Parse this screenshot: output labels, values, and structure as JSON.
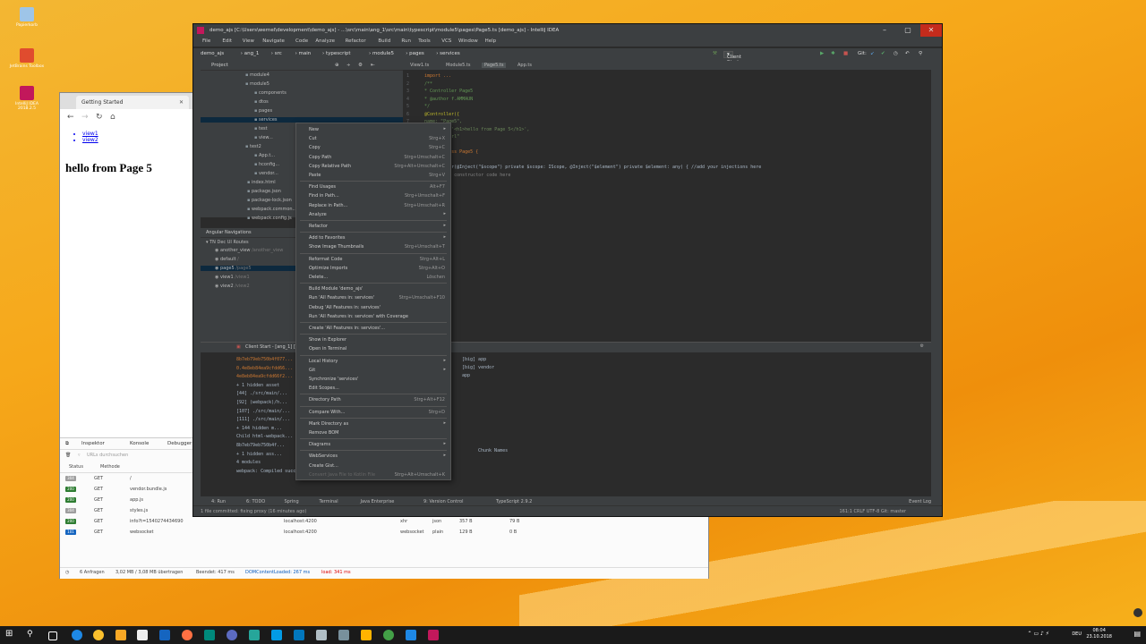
{
  "desktop": {
    "icons": [
      {
        "label": "Papierkorb",
        "color": "#9ec5e8"
      },
      {
        "label": "JetBrains Toolbox",
        "color": "#e04c2e"
      },
      {
        "label": "IntelliJ IDEA 2018.2.5",
        "color": "#c2185b"
      }
    ]
  },
  "browser": {
    "tab_title": "Getting Started",
    "links": [
      "view1",
      "view2"
    ],
    "heading": "hello from Page 5",
    "devtools": {
      "tabs": [
        "Inspektor",
        "Konsole",
        "Debugger"
      ],
      "filter_placeholder": "URLs durchsuchen",
      "columns": {
        "status": "Status",
        "method": "Methode"
      },
      "rows": [
        {
          "status": "304",
          "method": "GET",
          "file": "/",
          "domain": "",
          "type": "",
          "transfer": "",
          "size": ""
        },
        {
          "status": "200",
          "method": "GET",
          "file": "vendor.bundle.js",
          "domain": "",
          "type": "",
          "transfer": "",
          "size": ""
        },
        {
          "status": "200",
          "method": "GET",
          "file": "app.js",
          "domain": "",
          "type": "",
          "transfer": "",
          "size": ""
        },
        {
          "status": "304",
          "method": "GET",
          "file": "styles.js",
          "domain": "",
          "type": "",
          "transfer": "",
          "size": ""
        },
        {
          "status": "200",
          "method": "GET",
          "file": "info?t=1540274434690",
          "domain": "localhost:4200",
          "type": "xhr",
          "subtype": "json",
          "transfer": "357 B",
          "size": "79 B"
        },
        {
          "status": "101",
          "method": "GET",
          "file": "websocket",
          "domain": "localhost:4200",
          "type": "websocket",
          "subtype": "plain",
          "transfer": "129 B",
          "size": "0 B"
        }
      ],
      "summary": {
        "requests": "6 Anfragen",
        "transferred": "3,02 MB / 3,08 MB übertragen",
        "finished": "Beendet: 417 ms",
        "dcl": "DOMContentLoaded: 267 ms",
        "load": "load: 341 ms"
      }
    }
  },
  "ide": {
    "title": "demo_ajs [C:\\Users\\wernel\\development\\demo_ajs] - ...\\src\\main\\ang_1\\src\\main\\typescript\\module5\\pages\\Page5.ts [demo_ajs] - IntelliJ IDEA",
    "menu": [
      "File",
      "Edit",
      "View",
      "Navigate",
      "Code",
      "Analyze",
      "Refactor",
      "Build",
      "Run",
      "Tools",
      "VCS",
      "Window",
      "Help"
    ],
    "breadcrumbs": [
      "demo_ajs",
      "ang_1",
      "src",
      "main",
      "typescript",
      "module5",
      "pages",
      "services"
    ],
    "run_config": "Client Start - [ang_1] [TinyDao]",
    "git_label": "Git:",
    "project_panel_title": "Project",
    "tree": [
      {
        "label": "module4",
        "indent": 1
      },
      {
        "label": "module5",
        "indent": 1
      },
      {
        "label": "components",
        "indent": 2
      },
      {
        "label": "dtos",
        "indent": 2
      },
      {
        "label": "pages",
        "indent": 2
      },
      {
        "label": "services",
        "indent": 2,
        "selected": true
      },
      {
        "label": "test",
        "indent": 2
      },
      {
        "label": "view...",
        "indent": 2
      },
      {
        "label": "test2",
        "indent": 1
      },
      {
        "label": "App.t...",
        "indent": 2
      },
      {
        "label": "hconfig...",
        "indent": 2
      },
      {
        "label": "vendor...",
        "indent": 2
      },
      {
        "label": "index.html",
        "indent": 0
      },
      {
        "label": "package.json",
        "indent": 0
      },
      {
        "label": "package-lock.json",
        "indent": 0
      },
      {
        "label": "webpack.common...",
        "indent": 0
      },
      {
        "label": "webpack.config.js",
        "indent": 0
      }
    ],
    "editor_tabs": [
      "View1.ts",
      "Module5.ts",
      "Page5.ts",
      "App.ts"
    ],
    "code_lines": [
      {
        "text": "import ...",
        "color": "#cc7832"
      },
      {
        "text": "/**",
        "color": "#629755"
      },
      {
        "text": " * Controller Page5",
        "color": "#629755"
      },
      {
        "text": " * @author f.AMMAUN",
        "color": "#629755"
      },
      {
        "text": " */",
        "color": "#629755"
      },
      {
        "text": "@Controller({",
        "color": "#bbb529"
      },
      {
        "text": "    name: \"Page5\",",
        "color": "#6a8759"
      },
      {
        "text": "    template: '<h1>hello from Page 5</h1>',",
        "color": "#6a8759"
      },
      {
        "text": "    alias: \"ctrl\"",
        "color": "#6a8759"
      },
      {
        "text": "})",
        "color": "#a9b7c6"
      },
      {
        "text": "export class Page5 {",
        "color": "#cc7832"
      },
      {
        "text": "",
        "color": "#a9b7c6"
      },
      {
        "text": "    constructor(@Inject(\"$scope\") private $scope: IScope, @Inject(\"$element\") private $element: any) { //add your injections here",
        "color": "#a9b7c6"
      },
      {
        "text": "        //add your constructor code here",
        "color": "#808080"
      },
      {
        "text": "    }",
        "color": "#a9b7c6"
      },
      {
        "text": "}",
        "color": "#a9b7c6"
      }
    ],
    "angular_nav": {
      "title": "Angular Navigations",
      "group": "TN Dec UI Routes",
      "items": [
        {
          "label": "another_view",
          "path": "/another_view"
        },
        {
          "label": "default",
          "path": "/"
        },
        {
          "label": "page5",
          "path": "/page5",
          "selected": true
        },
        {
          "label": "view1",
          "path": "/view1"
        },
        {
          "label": "view2",
          "path": "/view2"
        }
      ]
    },
    "run_panel": {
      "title": "Client Start - [ang_1] [TinyDao]",
      "lines": [
        "8b7eb79eb750b4f077...",
        "0.4e8eb84ea9cfdd66...",
        "4e8eb84ea9cfdd66f2...",
        "+ 1 hidden asset",
        "[44] ./src/main/...",
        "[92] (webpack)/h...",
        "[107] ./src/main/...",
        "[111] ./src/main/...",
        "+ 144 hidden m...",
        "Child html-webpack...",
        "8b7eb79eb750b4f...",
        "+ 1 hidden ass...",
        "4 modules",
        "webpack: Compiled successfully."
      ],
      "right": [
        "[big]  app",
        "[big]  vendor",
        "       app",
        "Chunk Names"
      ]
    },
    "bottom_tabs": [
      "4: Run",
      "6: TODO",
      "Spring",
      "Terminal",
      "Java Enterprise",
      "9: Version Control",
      "TypeScript 2.9.2"
    ],
    "event_log": "Event Log",
    "status_left": "1 file committed: fixing proxy (16 minutes ago)",
    "status_right": "161:1  CRLF  UTF-8  Git: master"
  },
  "context_menu": [
    {
      "label": "New",
      "sub": true
    },
    {
      "label": "Cut",
      "sc": "Strg+X"
    },
    {
      "label": "Copy",
      "sc": "Strg+C"
    },
    {
      "label": "Copy Path",
      "sc": "Strg+Umschalt+C"
    },
    {
      "label": "Copy Relative Path",
      "sc": "Strg+Alt+Umschalt+C"
    },
    {
      "label": "Paste",
      "sc": "Strg+V"
    },
    {
      "sep": true
    },
    {
      "label": "Find Usages",
      "sc": "Alt+F7"
    },
    {
      "label": "Find in Path...",
      "sc": "Strg+Umschalt+F"
    },
    {
      "label": "Replace in Path...",
      "sc": "Strg+Umschalt+R"
    },
    {
      "label": "Analyze",
      "sub": true
    },
    {
      "sep": true
    },
    {
      "label": "Refactor",
      "sub": true
    },
    {
      "sep": true
    },
    {
      "label": "Add to Favorites",
      "sub": true
    },
    {
      "label": "Show Image Thumbnails",
      "sc": "Strg+Umschalt+T"
    },
    {
      "sep": true
    },
    {
      "label": "Reformat Code",
      "sc": "Strg+Alt+L"
    },
    {
      "label": "Optimize Imports",
      "sc": "Strg+Alt+O"
    },
    {
      "label": "Delete...",
      "sc": "Löschen"
    },
    {
      "sep": true
    },
    {
      "label": "Build Module 'demo_ajs'"
    },
    {
      "label": "Run 'All Features in: services'",
      "sc": "Strg+Umschalt+F10"
    },
    {
      "label": "Debug 'All Features in: services'"
    },
    {
      "label": "Run 'All Features in: services' with Coverage"
    },
    {
      "sep": true
    },
    {
      "label": "Create 'All Features in: services'..."
    },
    {
      "sep": true
    },
    {
      "label": "Show in Explorer"
    },
    {
      "label": "Open in Terminal"
    },
    {
      "sep": true
    },
    {
      "label": "Local History",
      "sub": true
    },
    {
      "label": "Git",
      "sub": true
    },
    {
      "label": "Synchronize 'services'"
    },
    {
      "label": "Edit Scopes..."
    },
    {
      "sep": true
    },
    {
      "label": "Directory Path",
      "sc": "Strg+Alt+F12"
    },
    {
      "sep": true
    },
    {
      "label": "Compare With...",
      "sc": "Strg+D"
    },
    {
      "sep": true
    },
    {
      "label": "Mark Directory as",
      "sub": true
    },
    {
      "label": "Remove BOM"
    },
    {
      "sep": true
    },
    {
      "label": "Diagrams",
      "sub": true
    },
    {
      "sep": true
    },
    {
      "label": "WebServices",
      "sub": true
    },
    {
      "label": "Create Gist..."
    },
    {
      "label": "Convert Java File to Kotlin File",
      "sc": "Strg+Alt+Umschalt+K",
      "disabled": true
    }
  ],
  "taskbar": {
    "time": "08:04",
    "date": "23.10.2018",
    "lang": "DEU"
  }
}
